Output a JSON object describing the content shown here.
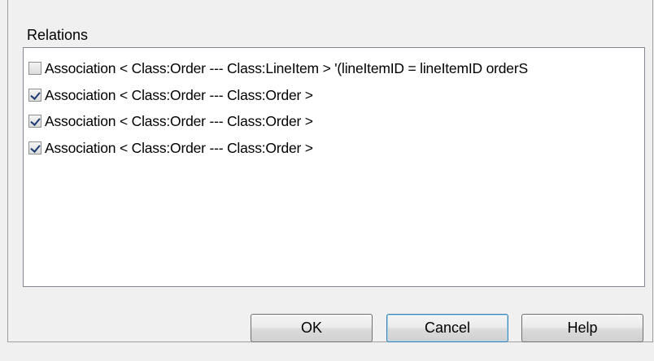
{
  "relations": {
    "label": "Relations",
    "items": [
      {
        "checked": false,
        "text": "Association < Class:Order --- Class:LineItem > '(lineItemID = lineItemID orderS"
      },
      {
        "checked": true,
        "text": "Association < Class:Order --- Class:Order >"
      },
      {
        "checked": true,
        "text": "Association < Class:Order --- Class:Order >"
      },
      {
        "checked": true,
        "text": "Association < Class:Order --- Class:Order >"
      }
    ]
  },
  "buttons": {
    "ok": "OK",
    "cancel": "Cancel",
    "help": "Help"
  }
}
